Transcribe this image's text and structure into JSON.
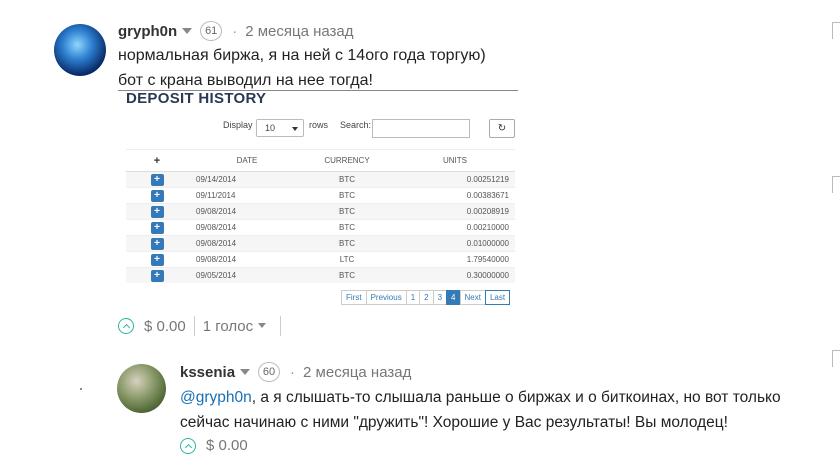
{
  "comments": [
    {
      "author": "gryph0n",
      "reputation": "61",
      "time": "2 месяца назад",
      "lines": [
        "нормальная биржа, я на ней с 14ого года торгую)",
        "бот с крана выводил на нее тогда!"
      ],
      "payout": "$ 0.00",
      "votes": "1 голос"
    },
    {
      "author": "kssenia",
      "reputation": "60",
      "time": "2 месяца назад",
      "mention": "@gryph0n",
      "line1_rest": ", а я слышать-то слышала раньше о биржах и о биткоинах, но вот только",
      "line2": "сейчас начинаю с ними \"дружить\"! Хорошие у Вас результаты! Вы молодец!",
      "payout": "$ 0.00"
    }
  ],
  "embed": {
    "title": "DEPOSIT HISTORY",
    "display_label": "Display",
    "display_value": "10",
    "rows_label": "rows",
    "search_label": "Search:",
    "refresh_icon": "↻",
    "headers": [
      "+",
      "DATE",
      "CURRENCY",
      "UNITS"
    ],
    "rows": [
      {
        "date": "09/14/2014",
        "currency": "BTC",
        "units": "0.00251219"
      },
      {
        "date": "09/11/2014",
        "currency": "BTC",
        "units": "0.00383671"
      },
      {
        "date": "09/08/2014",
        "currency": "BTC",
        "units": "0.00208919"
      },
      {
        "date": "09/08/2014",
        "currency": "BTC",
        "units": "0.00210000"
      },
      {
        "date": "09/08/2014",
        "currency": "BTC",
        "units": "0.01000000"
      },
      {
        "date": "09/08/2014",
        "currency": "LTC",
        "units": "1.79540000"
      },
      {
        "date": "09/05/2014",
        "currency": "BTC",
        "units": "0.30000000"
      }
    ],
    "pager": [
      "First",
      "Previous",
      "1",
      "2",
      "3",
      "4",
      "Next",
      "Last"
    ],
    "pager_active": "4"
  },
  "colors": {
    "accent": "#2bb5a0",
    "link": "#1a6fb3",
    "button": "#337ab7"
  }
}
